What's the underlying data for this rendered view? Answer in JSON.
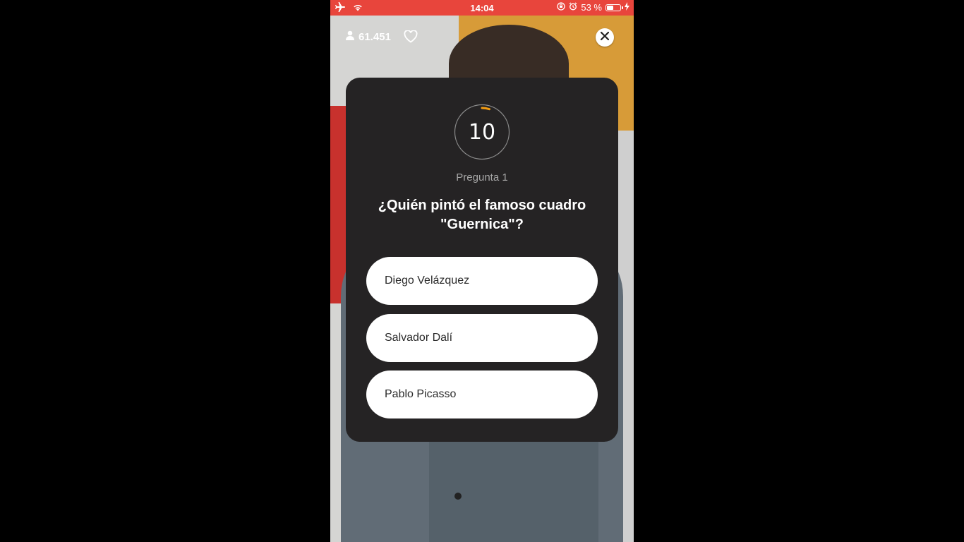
{
  "status_bar": {
    "time": "14:04",
    "battery_percent": "53 %",
    "battery_level": 0.53
  },
  "overlay": {
    "viewer_count": "61.451"
  },
  "quiz": {
    "timer_value": "10",
    "timer_progress": 0.05,
    "question_label": "Pregunta 1",
    "question_text": "¿Quién pintó el famoso cuadro \"Guernica\"?",
    "answers": [
      "Diego Velázquez",
      "Salvador Dalí",
      "Pablo Picasso"
    ]
  },
  "colors": {
    "status_bar": "#e8453c",
    "card_background": "#252324",
    "timer_accent": "#f39c12",
    "answer_background": "#ffffff"
  }
}
